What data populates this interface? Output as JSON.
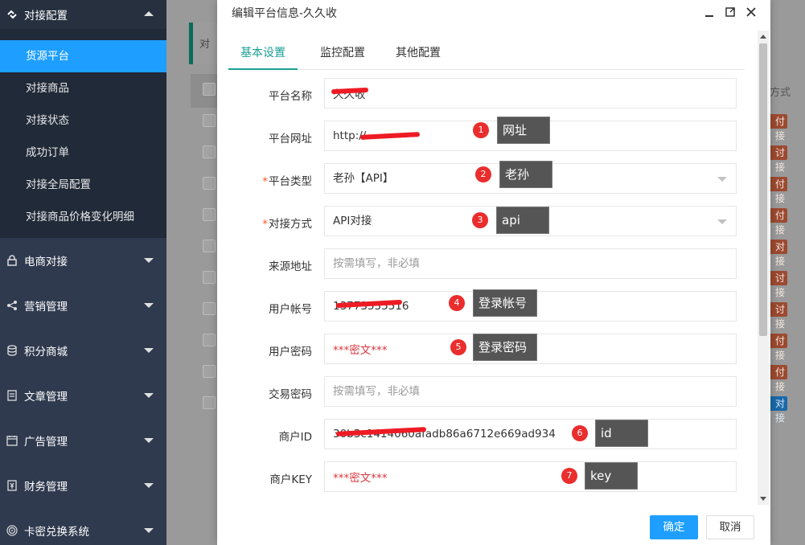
{
  "sidebar": {
    "top_group": "对接配置",
    "sub_items": [
      "货源平台",
      "对接商品",
      "对接状态",
      "成功订单",
      "对接全局配置",
      "对接商品价格变化明细"
    ],
    "active_index": 0,
    "groups": [
      "电商对接",
      "营销管理",
      "积分商城",
      "文章管理",
      "广告管理",
      "财务管理",
      "卡密兑换系统"
    ]
  },
  "background": {
    "breadcrumb_partial": "对",
    "column_title_partial": "方式",
    "row_tags": [
      "付接",
      "讨接",
      "付接",
      "付接",
      "对接",
      "讨接",
      "讨接",
      "付接",
      "付接"
    ],
    "last_tag": "对接"
  },
  "modal": {
    "title": "编辑平台信息-久久收",
    "tabs": [
      "基本设置",
      "监控配置",
      "其他配置"
    ],
    "active_tab": 0,
    "fields": {
      "platform_name": {
        "label": "平台名称",
        "value": "久久收"
      },
      "platform_url": {
        "label": "平台网址",
        "value": "http://"
      },
      "platform_type": {
        "label": "平台类型",
        "value": "老孙【API】",
        "required": true
      },
      "connect_method": {
        "label": "对接方式",
        "value": "API对接",
        "required": true
      },
      "source_addr": {
        "label": "来源地址",
        "placeholder": "按需填写，非必填"
      },
      "user_account": {
        "label": "用户帐号",
        "value": "13773535516"
      },
      "user_password": {
        "label": "用户密码",
        "value": "***密文***"
      },
      "trade_password": {
        "label": "交易密码",
        "placeholder": "按需填写，非必填"
      },
      "merchant_id": {
        "label": "商户ID",
        "value": "30b3c1414060afadb86a6712e669ad934"
      },
      "merchant_key": {
        "label": "商户KEY",
        "value": "***密文***"
      }
    },
    "annotations": [
      {
        "num": "1",
        "text": "网址"
      },
      {
        "num": "2",
        "text": "老孙"
      },
      {
        "num": "3",
        "text": "api"
      },
      {
        "num": "4",
        "text": "登录帐号"
      },
      {
        "num": "5",
        "text": "登录密码"
      },
      {
        "num": "6",
        "text": "id"
      },
      {
        "num": "7",
        "text": "key"
      }
    ],
    "buttons": {
      "ok": "确定",
      "cancel": "取消"
    }
  }
}
